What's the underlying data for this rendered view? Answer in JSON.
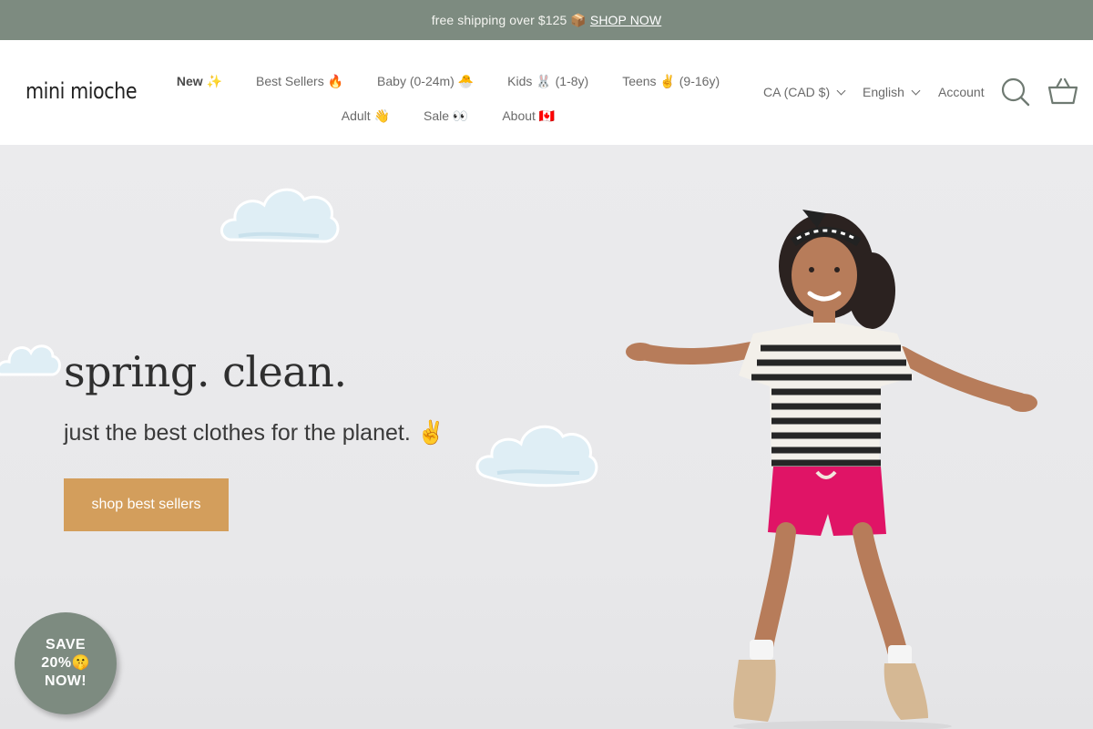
{
  "announcement": {
    "text": "free shipping over $125 📦",
    "link": "SHOP NOW"
  },
  "header": {
    "logo": "mini mioche",
    "nav_row1": [
      "New ✨",
      "Best Sellers 🔥",
      "Baby (0-24m) 🐣",
      "Kids 🐰 (1-8y)",
      "Teens ✌️ (9-16y)"
    ],
    "nav_row2": [
      "Adult 👋",
      "Sale 👀",
      "About 🇨🇦"
    ],
    "currency": "CA (CAD $)",
    "language": "English",
    "account": "Account",
    "icons": [
      "search-icon",
      "basket-icon"
    ]
  },
  "hero": {
    "title": "spring. clean.",
    "subtitle": "just the best clothes for the planet. ✌️",
    "button": "shop best sellers"
  },
  "badge": {
    "line1": "SAVE",
    "line2": "20%🤫",
    "line3": "NOW!"
  },
  "colors": {
    "announcement_bg": "#7d8b80",
    "button_bg": "#d39e5c",
    "hero_bg": "#eaeaec"
  }
}
